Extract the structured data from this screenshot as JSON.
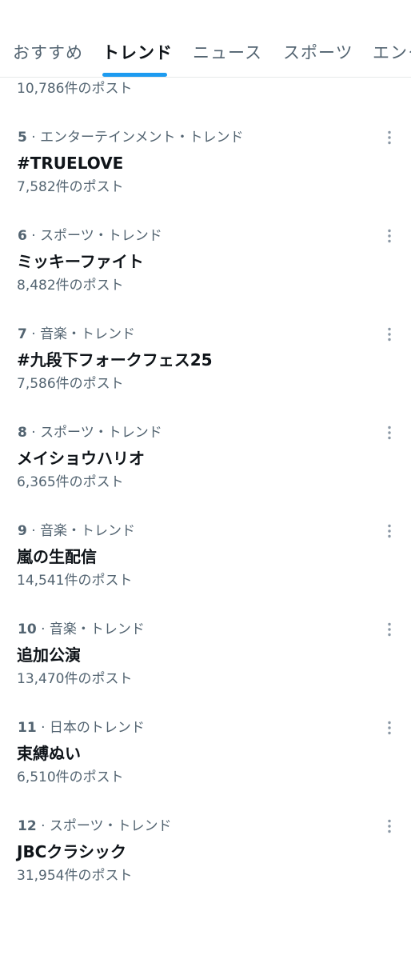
{
  "tabs": [
    {
      "label": "おすすめ",
      "active": false
    },
    {
      "label": "トレンド",
      "active": true
    },
    {
      "label": "ニュース",
      "active": false
    },
    {
      "label": "スポーツ",
      "active": false
    },
    {
      "label": "エンタ",
      "active": false
    }
  ],
  "partial_item": {
    "count": "10,786件のポスト"
  },
  "trends": [
    {
      "rank": "5",
      "category": "エンターテインメント・トレンド",
      "name": "#TRUELOVE",
      "count": "7,582件のポスト"
    },
    {
      "rank": "6",
      "category": "スポーツ・トレンド",
      "name": "ミッキーファイト",
      "count": "8,482件のポスト"
    },
    {
      "rank": "7",
      "category": "音楽・トレンド",
      "name": "#九段下フォークフェス25",
      "count": "7,586件のポスト"
    },
    {
      "rank": "8",
      "category": "スポーツ・トレンド",
      "name": "メイショウハリオ",
      "count": "6,365件のポスト"
    },
    {
      "rank": "9",
      "category": "音楽・トレンド",
      "name": "嵐の生配信",
      "count": "14,541件のポスト"
    },
    {
      "rank": "10",
      "category": "音楽・トレンド",
      "name": "追加公演",
      "count": "13,470件のポスト"
    },
    {
      "rank": "11",
      "category": "日本のトレンド",
      "name": "束縛ぬい",
      "count": "6,510件のポスト"
    },
    {
      "rank": "12",
      "category": "スポーツ・トレンド",
      "name": "JBCクラシック",
      "count": "31,954件のポスト"
    }
  ],
  "separator": " · ",
  "icons": {
    "more": "more-vertical-icon"
  },
  "colors": {
    "accent": "#1d9bf0",
    "primary_text": "#0f1419",
    "secondary_text": "#536471",
    "divider": "#e7e9ea"
  }
}
